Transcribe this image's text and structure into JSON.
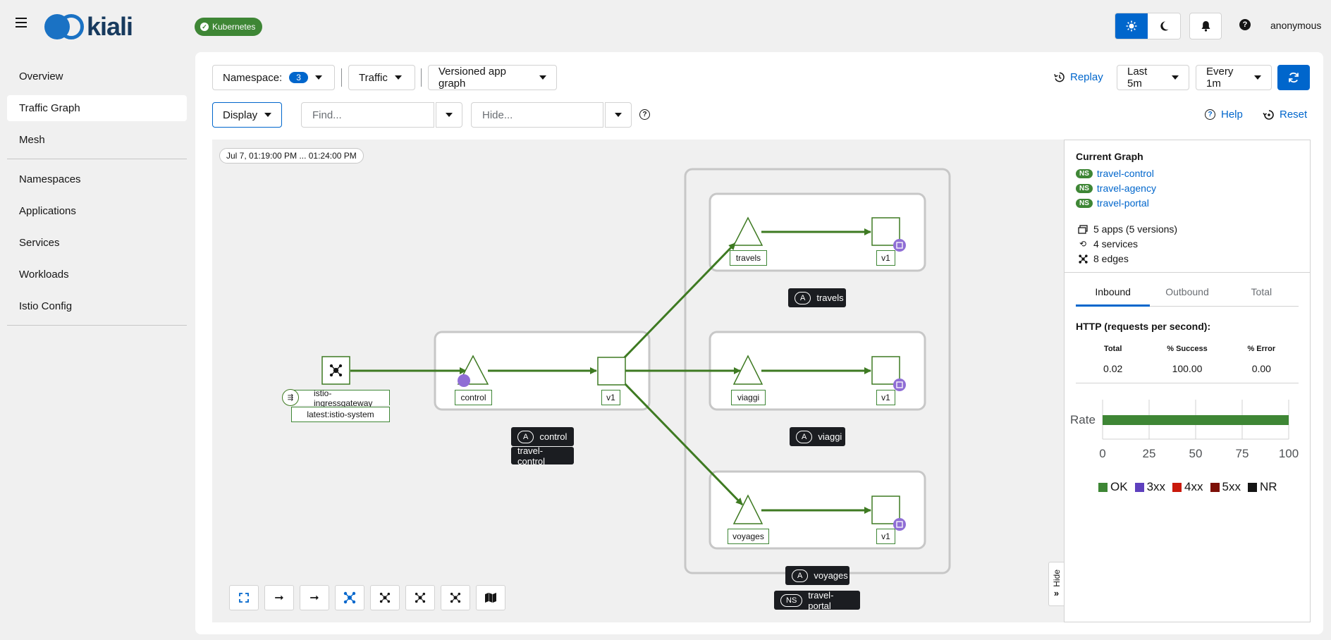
{
  "masthead": {
    "logo_text": "kiali",
    "cluster_badge": "Kubernetes",
    "user": "anonymous",
    "colors": {
      "brand_blue": "#0066cc",
      "logo_navy": "#173a5e",
      "ok_green": "#3e8635"
    }
  },
  "sidebar": {
    "items": [
      {
        "label": "Overview",
        "active": false
      },
      {
        "label": "Traffic Graph",
        "active": true
      },
      {
        "label": "Mesh",
        "active": false
      },
      {
        "label": "Namespaces",
        "active": false
      },
      {
        "label": "Applications",
        "active": false
      },
      {
        "label": "Services",
        "active": false
      },
      {
        "label": "Workloads",
        "active": false
      },
      {
        "label": "Istio Config",
        "active": false
      }
    ]
  },
  "toolbar": {
    "namespace_label": "Namespace:",
    "namespace_count": "3",
    "traffic_label": "Traffic",
    "graph_type_label": "Versioned app graph",
    "replay_label": "Replay",
    "duration_label": "Last 5m",
    "refresh_interval_label": "Every 1m",
    "display_label": "Display",
    "find_placeholder": "Find...",
    "hide_placeholder": "Hide...",
    "help_label": "Help",
    "reset_label": "Reset"
  },
  "graph": {
    "time_range": "Jul 7, 01:19:00 PM ... 01:24:00 PM",
    "nodes": {
      "gateway_name": "istio-ingressgateway",
      "gateway_sub": "latest:istio-system",
      "control_app": "control",
      "control_version": "v1",
      "travels_app": "travels",
      "travels_version": "v1",
      "viaggi_app": "viaggi",
      "viaggi_version": "v1",
      "voyages_app": "voyages",
      "voyages_version": "v1"
    },
    "group_tags": {
      "app_abbr": "A",
      "ns_abbr": "NS",
      "control": "control",
      "control_ns": "travel-control",
      "travels": "travels",
      "viaggi": "viaggi",
      "voyages": "voyages",
      "portal_ns": "travel-portal"
    },
    "hide_tab_label": "Hide"
  },
  "panel": {
    "title": "Current Graph",
    "ns_badge": "NS",
    "namespaces": [
      "travel-control",
      "travel-agency",
      "travel-portal"
    ],
    "stats": {
      "apps": "5 apps (5 versions)",
      "services": "4 services",
      "edges": "8 edges"
    },
    "tabs": [
      "Inbound",
      "Outbound",
      "Total"
    ],
    "http_title": "HTTP (requests per second):",
    "table": {
      "headers": [
        "Total",
        "% Success",
        "% Error"
      ],
      "values": [
        "0.02",
        "100.00",
        "0.00"
      ]
    },
    "chart": {
      "ylabel": "Rate",
      "ticks": [
        "0",
        "25",
        "50",
        "75",
        "100"
      ],
      "ok_percent": 100
    },
    "legend": [
      {
        "label": "OK",
        "color": "#3e8635"
      },
      {
        "label": "3xx",
        "color": "#5e40be"
      },
      {
        "label": "4xx",
        "color": "#c9190b"
      },
      {
        "label": "5xx",
        "color": "#7d1007"
      },
      {
        "label": "NR",
        "color": "#151515"
      }
    ]
  }
}
